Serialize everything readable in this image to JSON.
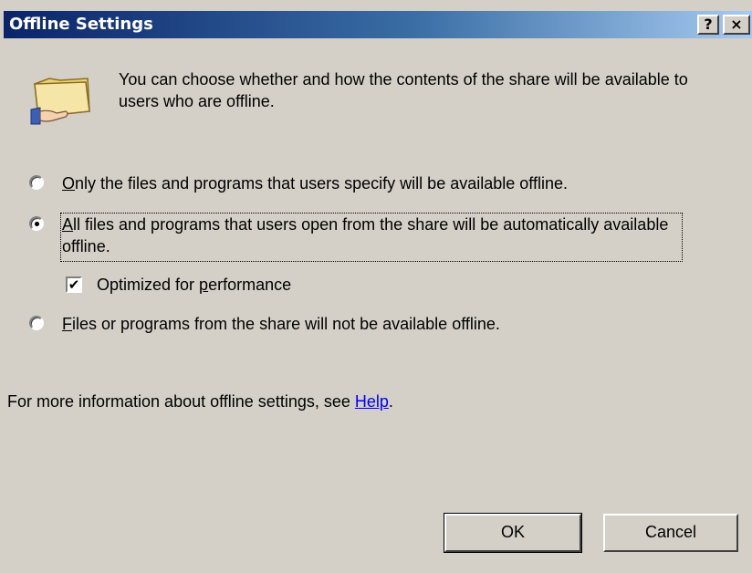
{
  "window": {
    "title": "Offline Settings",
    "help_button": "?",
    "close_button": "×"
  },
  "intro": {
    "icon": "shared-folder-icon",
    "text": "You can choose whether and how the contents of the share will be available to users who are offline."
  },
  "options": [
    {
      "mnemonic": "O",
      "label_rest": "nly the files and programs that users specify will be available offline.",
      "selected": false
    },
    {
      "mnemonic": "A",
      "label_rest": "ll files and programs that users open from the share will be automatically available offline.",
      "selected": true
    },
    {
      "mnemonic": "F",
      "label_rest": "iles or programs from the share will not be available offline.",
      "selected": false
    }
  ],
  "optimize": {
    "label_before": "Optimized for ",
    "mnemonic": "p",
    "label_after": "erformance",
    "checked": true
  },
  "footer": {
    "text": "For more information about offline settings, see ",
    "link": "Help",
    "end": "."
  },
  "buttons": {
    "ok": "OK",
    "cancel": "Cancel"
  },
  "colors": {
    "face": "#d4d0c8",
    "title_start": "#0a246a",
    "title_end": "#a6caf0",
    "link": "#0000ff"
  }
}
